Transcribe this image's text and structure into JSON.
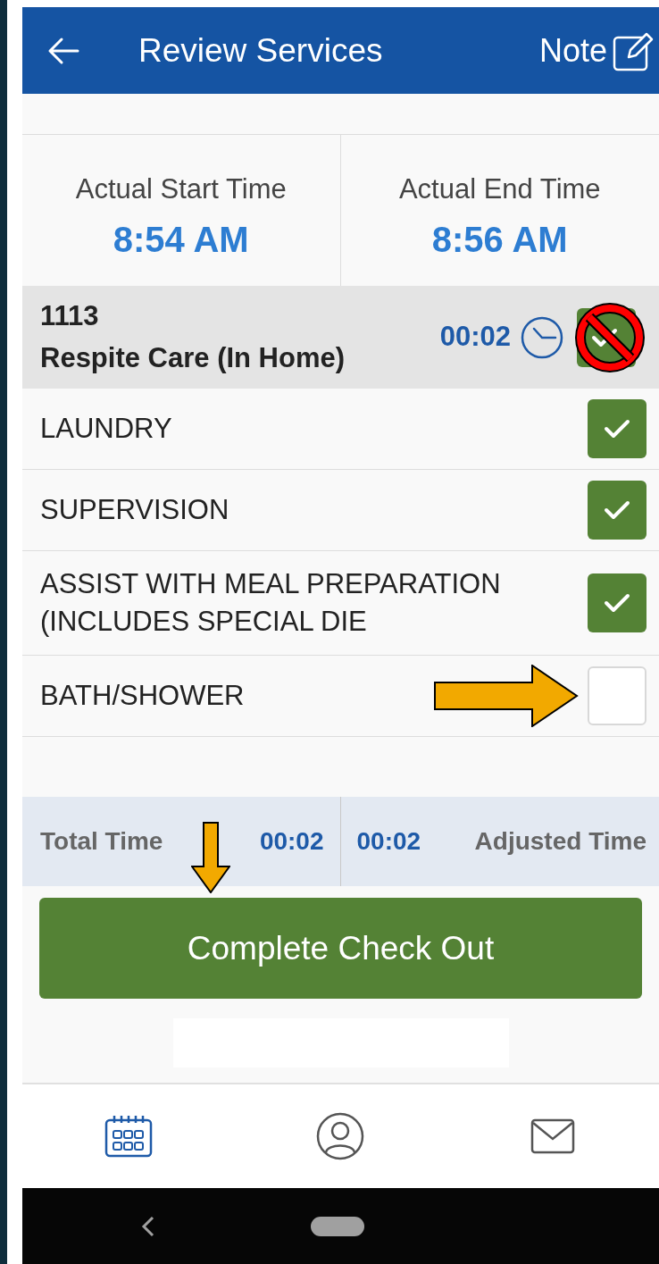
{
  "header": {
    "title": "Review Services",
    "note_label": "Note"
  },
  "times": [
    {
      "label": "Actual Start Time",
      "value": "8:54 AM"
    },
    {
      "label": "Actual End Time",
      "value": "8:56 AM"
    }
  ],
  "service": {
    "code": "1113",
    "name": "Respite Care (In Home)",
    "duration": "00:02",
    "checked": true,
    "blocked": true
  },
  "tasks": [
    {
      "label": "LAUNDRY",
      "checked": true,
      "arrow": false
    },
    {
      "label": "SUPERVISION",
      "checked": true,
      "arrow": false
    },
    {
      "label": "ASSIST WITH MEAL PREPARATION (INCLUDES SPECIAL DIE",
      "checked": true,
      "arrow": false
    },
    {
      "label": "BATH/SHOWER",
      "checked": false,
      "arrow": true
    }
  ],
  "totals": {
    "total_label": "Total Time",
    "total_value": "00:02",
    "adjusted_value": "00:02",
    "adjusted_label": "Adjusted Time"
  },
  "complete_button": {
    "label": "Complete Check Out",
    "arrow": true
  },
  "nav": [
    {
      "kind": "calendar",
      "selected": true
    },
    {
      "kind": "profile",
      "selected": false
    },
    {
      "kind": "mail",
      "selected": false
    }
  ]
}
